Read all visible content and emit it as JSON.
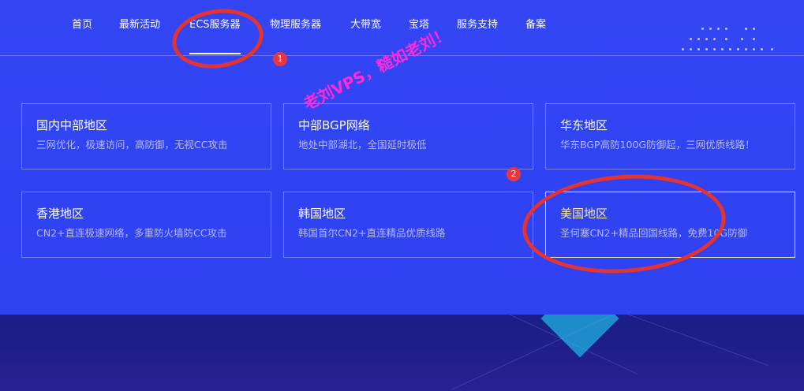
{
  "nav": {
    "items": [
      {
        "label": "首页"
      },
      {
        "label": "最新活动"
      },
      {
        "label": "ECS服务器"
      },
      {
        "label": "物理服务器"
      },
      {
        "label": "大带宽"
      },
      {
        "label": "宝塔"
      },
      {
        "label": "服务支持"
      },
      {
        "label": "备案"
      }
    ],
    "active": "ECS服务器"
  },
  "regions": [
    {
      "title": "国内中部地区",
      "desc": "三网优化，极速访问，高防御，无视CC攻击"
    },
    {
      "title": "中部BGP网络",
      "desc": "地处中部湖北，全国延时极低"
    },
    {
      "title": "华东地区",
      "desc": "华东BGP高防100G防御起，三网优质线路！"
    },
    {
      "title": "香港地区",
      "desc": "CN2+直连极速网络，多重防火墙防CC攻击"
    },
    {
      "title": "韩国地区",
      "desc": "韩国首尔CN2+直连精品优质线路"
    },
    {
      "title": "美国地区",
      "desc": "圣何塞CN2+精品回国线路，免费10G防御"
    }
  ],
  "annotations": {
    "badge1": "1",
    "badge2": "2",
    "watermark": "老刘VPS，糙如老刘！",
    "circle_color": "#e5342f",
    "watermark_color": "#ff2bd9"
  },
  "colors": {
    "panel_bg": "#3446f4",
    "bottom_bg": "#1b1f8a",
    "highlight_title": "#f6e6a8"
  }
}
